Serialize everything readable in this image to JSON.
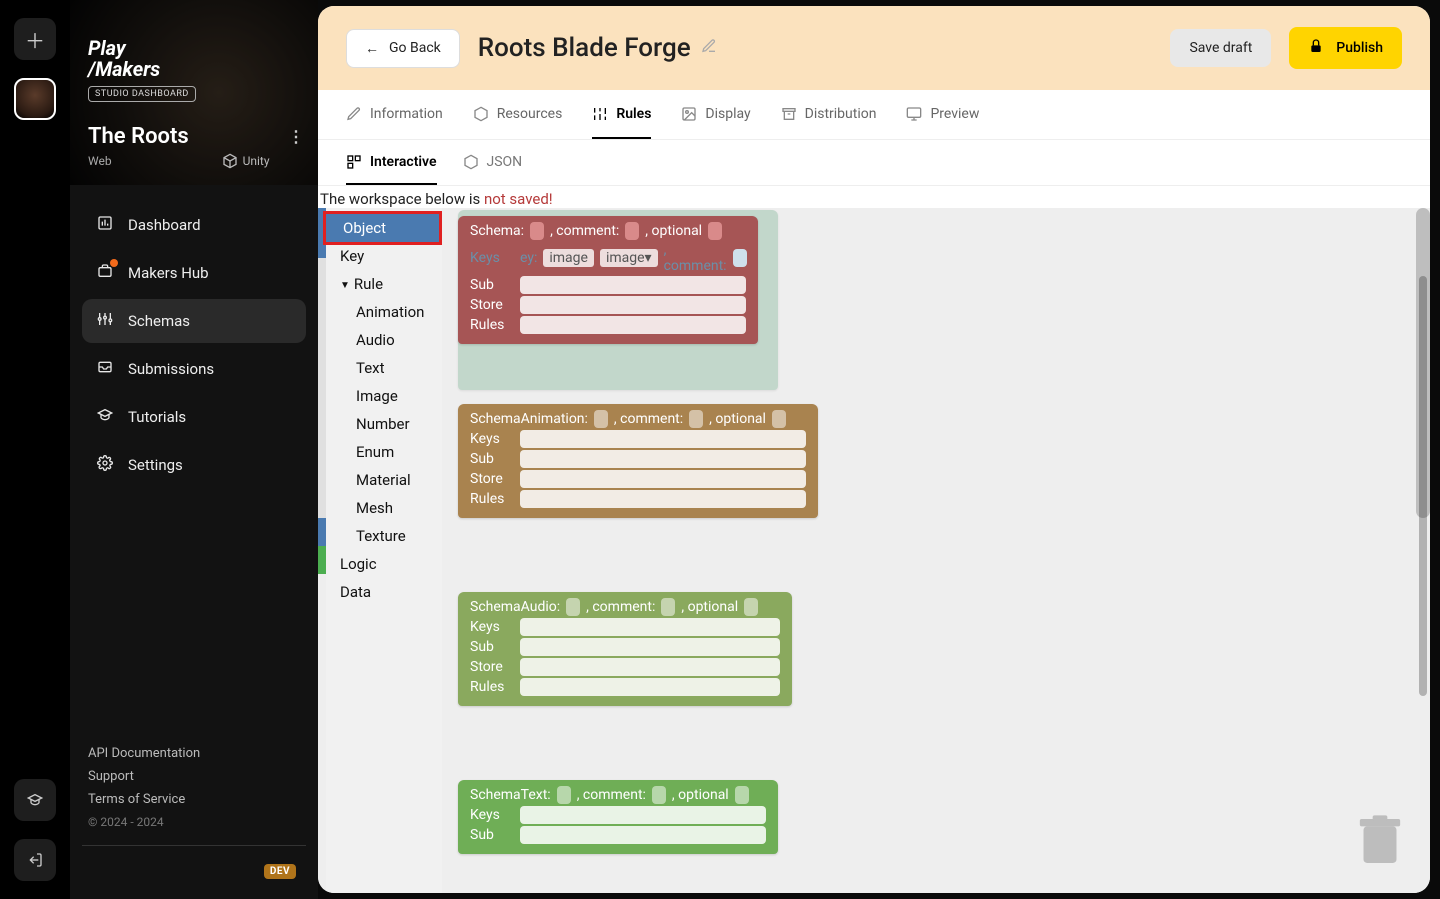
{
  "rail": {
    "add": "＋"
  },
  "brand": {
    "line1": "Play",
    "line2": "/Makers",
    "badge": "STUDIO DASHBOARD"
  },
  "project": {
    "name": "The Roots",
    "platform": "Web",
    "engine": "Unity"
  },
  "nav": {
    "dashboard": "Dashboard",
    "makershub": "Makers Hub",
    "schemas": "Schemas",
    "submissions": "Submissions",
    "tutorials": "Tutorials",
    "settings": "Settings"
  },
  "footer": {
    "api": "API Documentation",
    "support": "Support",
    "tos": "Terms of Service",
    "copyright": "© 2024 - 2024",
    "dev": "DEV"
  },
  "header": {
    "goBack": "Go Back",
    "title": "Roots Blade Forge",
    "saveDraft": "Save draft",
    "publish": "Publish"
  },
  "tabs": {
    "information": "Information",
    "resources": "Resources",
    "rules": "Rules",
    "display": "Display",
    "distribution": "Distribution",
    "preview": "Preview"
  },
  "subtabs": {
    "interactive": "Interactive",
    "json": "JSON"
  },
  "warning": {
    "prefix": "The workspace below is ",
    "unsaved": "not saved!"
  },
  "toolbox": {
    "object": "Object",
    "key": "Key",
    "rule": "Rule",
    "animation": "Animation",
    "audio": "Audio",
    "text": "Text",
    "image": "Image",
    "number": "Number",
    "enum": "Enum",
    "material": "Material",
    "mesh": "Mesh",
    "texture": "Texture",
    "logic": "Logic",
    "data": "Data"
  },
  "block_labels": {
    "schema": "Schema:",
    "schemaAnimation": "SchemaAnimation:",
    "schemaAudio": "SchemaAudio:",
    "schemaText": "SchemaText:",
    "comment": ", comment:",
    "optional": ", optional",
    "keys": "Keys",
    "sub": "Sub",
    "store": "Store",
    "rules": "Rules",
    "key": "Key:",
    "image": "image"
  }
}
